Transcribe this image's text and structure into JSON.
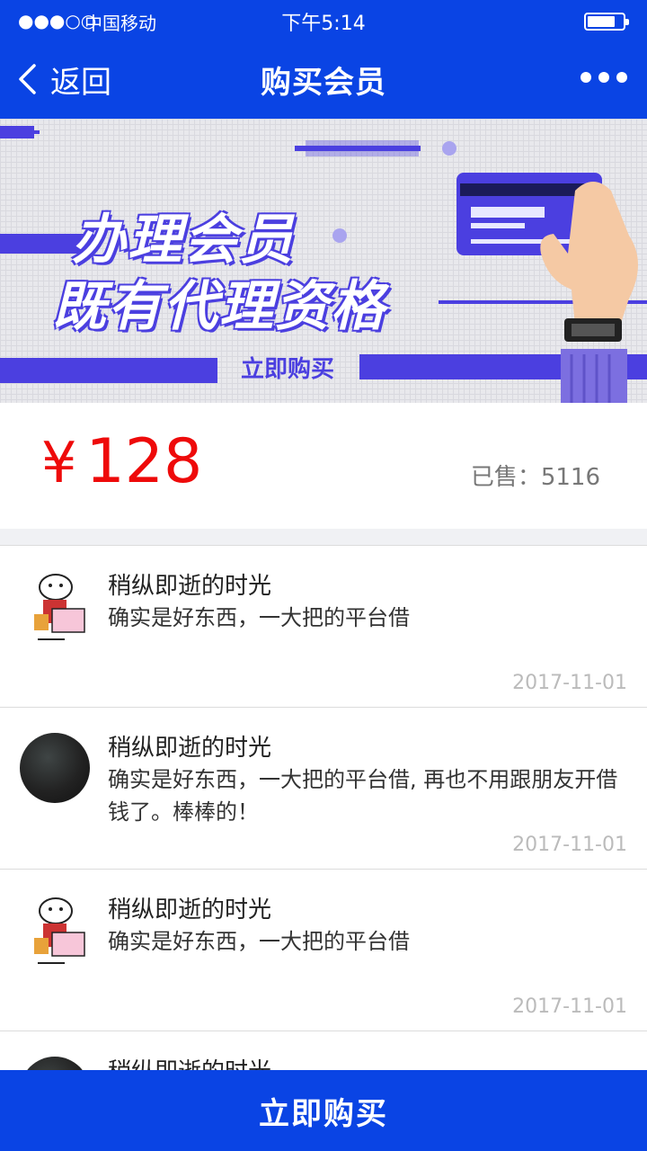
{
  "status": {
    "signal": "●●●○○",
    "carrier": "中国移动",
    "time": "下午5:14"
  },
  "nav": {
    "back_label": "返回",
    "title": "购买会员"
  },
  "banner": {
    "line1": "办理会员",
    "line2": "既有代理资格",
    "cta": "立即购买"
  },
  "product": {
    "currency": "¥",
    "price": "128",
    "sold_text": "已售：5116"
  },
  "comments": [
    {
      "avatar": "cartoon",
      "name": "稍纵即逝的时光",
      "text": "确实是好东西，一大把的平台借",
      "date": "2017-11-01"
    },
    {
      "avatar": "dark",
      "name": "稍纵即逝的时光",
      "text": "确实是好东西，一大把的平台借, 再也不用跟朋友开借钱了。棒棒的！",
      "date": "2017-11-01"
    },
    {
      "avatar": "cartoon",
      "name": "稍纵即逝的时光",
      "text": "确实是好东西，一大把的平台借",
      "date": "2017-11-01"
    },
    {
      "avatar": "dark",
      "name": "稍纵即逝的时光",
      "text": "",
      "date": ""
    }
  ],
  "footer": {
    "buy_label": "立即购买"
  },
  "colors": {
    "brand_blue": "#0a44e4",
    "banner_purple": "#4b3fe0",
    "price_red": "#ee0a0a"
  }
}
